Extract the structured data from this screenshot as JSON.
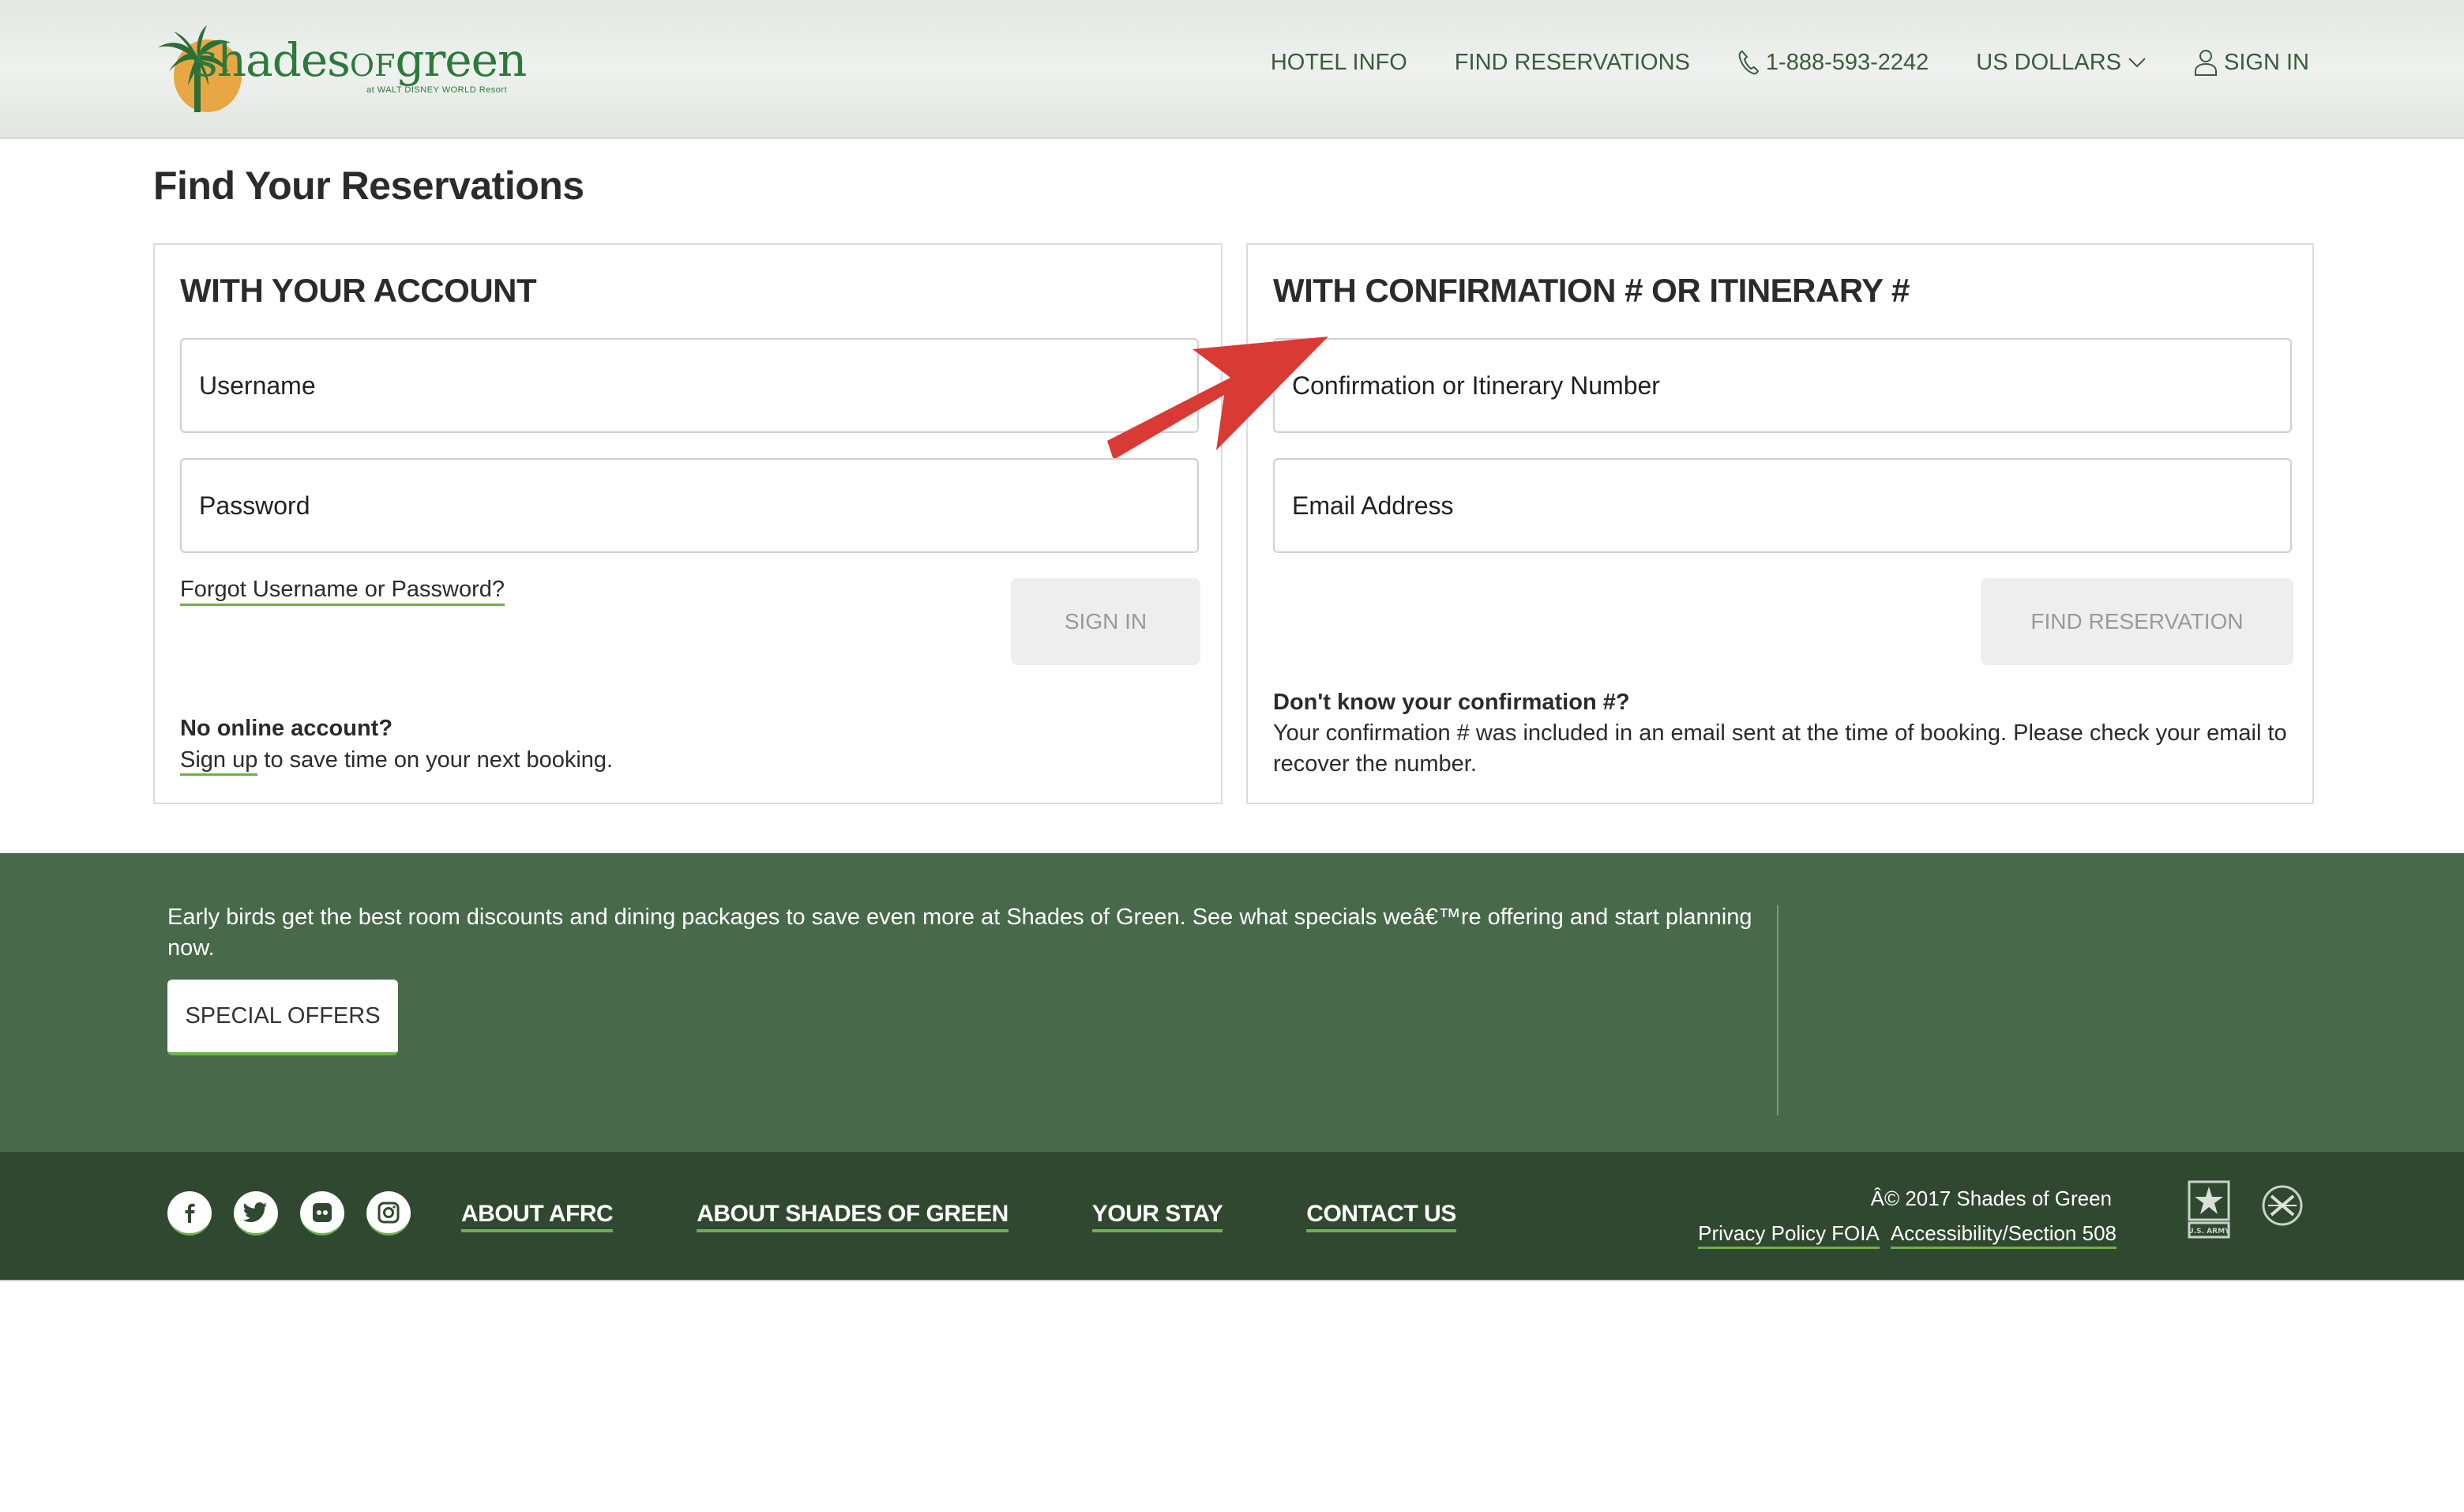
{
  "header": {
    "logo": {
      "wordmark_part1": "shades",
      "wordmark_part2": "OF",
      "wordmark_part3": "green",
      "tagline": "at WALT DISNEY WORLD Resort"
    },
    "nav": {
      "hotel_info": "HOTEL INFO",
      "find_reservations": "FIND RESERVATIONS",
      "phone": "1-888-593-2242",
      "phone_icon": "phone-icon",
      "currency": "US DOLLARS",
      "currency_icon": "chevron-down-icon",
      "sign_in": "SIGN IN",
      "sign_in_icon": "user-icon"
    }
  },
  "main": {
    "title": "Find Your Reservations",
    "account_panel": {
      "heading": "WITH YOUR ACCOUNT",
      "username_placeholder": "Username",
      "password_placeholder": "Password",
      "forgot_link": "Forgot Username or Password?",
      "sign_in_button": "SIGN IN",
      "no_account_question": "No online account?",
      "sign_up_link": "Sign up",
      "sign_up_suffix": " to save time on your next booking."
    },
    "confirmation_panel": {
      "heading": "WITH CONFIRMATION # OR ITINERARY #",
      "confirmation_placeholder": "Confirmation or Itinerary Number",
      "email_placeholder": "Email Address",
      "find_button": "FIND RESERVATION",
      "help_question": "Don't know your confirmation #?",
      "help_text": "Your confirmation # was included in an email sent at the time of booking. Please check your email to recover the number."
    },
    "annotation": {
      "type": "arrow",
      "color": "#d93a33"
    }
  },
  "promo": {
    "text": "Early birds get the best room discounts and dining packages to save even more at Shades of Green. See what specials weâ€™re offering and start planning now.",
    "button": "SPECIAL OFFERS"
  },
  "footer": {
    "social": [
      "facebook-icon",
      "twitter-icon",
      "flickr-icon",
      "instagram-icon"
    ],
    "links": [
      "ABOUT AFRC",
      "ABOUT SHADES OF GREEN",
      "YOUR STAY",
      "CONTACT US"
    ],
    "copyright": "Â© 2017 Shades of Green",
    "legal_links": [
      "Privacy Policy FOIA",
      "Accessibility/Section 508"
    ],
    "army_logo_text": "U.S. ARMY"
  },
  "colors": {
    "brand_green": "#2c7a3b",
    "nav_text": "#3d5a3d",
    "promo_bg": "#48694a",
    "footer_bg": "#304830",
    "link_underline": "#6db04c",
    "sun_orange": "#e8a645"
  }
}
